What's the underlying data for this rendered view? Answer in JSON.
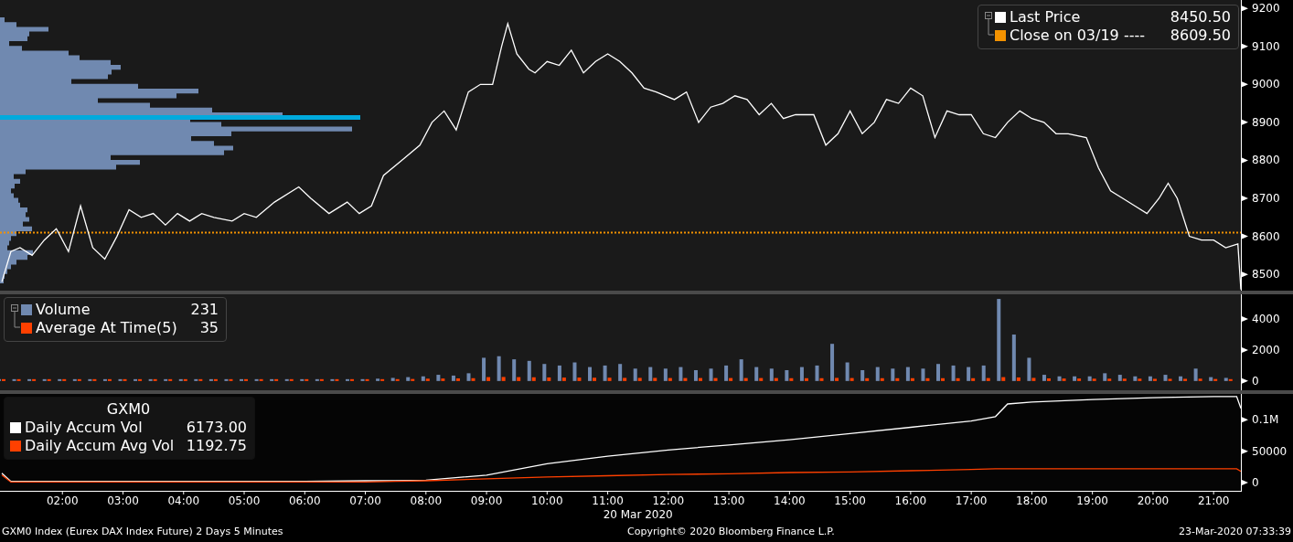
{
  "price_panel": {
    "legend_values": [
      "8450.50",
      "8609.50"
    ],
    "chart_data": {
      "type": "line",
      "legend": true,
      "xlim": [
        0.97,
        21.45
      ],
      "ylim": [
        8457,
        9222
      ],
      "yticks": [
        8500,
        8600,
        8700,
        8800,
        8900,
        9000,
        9100,
        9200
      ],
      "x": [
        1.0,
        1.15,
        1.3,
        1.5,
        1.7,
        1.9,
        2.1,
        2.3,
        2.5,
        2.7,
        2.9,
        3.1,
        3.3,
        3.5,
        3.7,
        3.9,
        4.1,
        4.3,
        4.5,
        4.8,
        5.0,
        5.2,
        5.5,
        5.9,
        6.1,
        6.4,
        6.7,
        6.9,
        7.1,
        7.3,
        7.6,
        7.9,
        8.1,
        8.3,
        8.5,
        8.7,
        8.9,
        9.1,
        9.25,
        9.35,
        9.5,
        9.7,
        9.8,
        10.0,
        10.2,
        10.4,
        10.6,
        10.8,
        11.0,
        11.2,
        11.4,
        11.6,
        11.8,
        12.1,
        12.3,
        12.5,
        12.7,
        12.9,
        13.1,
        13.3,
        13.5,
        13.7,
        13.9,
        14.1,
        14.4,
        14.6,
        14.8,
        15.0,
        15.2,
        15.4,
        15.6,
        15.8,
        16.0,
        16.2,
        16.4,
        16.6,
        16.8,
        17.0,
        17.2,
        17.4,
        17.6,
        17.8,
        18.0,
        18.2,
        18.4,
        18.6,
        18.9,
        19.1,
        19.3,
        19.5,
        19.7,
        19.9,
        20.1,
        20.25,
        20.4,
        20.6,
        20.8,
        21.0,
        21.2,
        21.4,
        21.45
      ],
      "series": [
        {
          "name": "Last Price",
          "color": "#ffffff",
          "values": [
            8480,
            8560,
            8570,
            8550,
            8590,
            8620,
            8560,
            8680,
            8570,
            8540,
            8600,
            8670,
            8650,
            8660,
            8630,
            8660,
            8640,
            8660,
            8650,
            8640,
            8660,
            8650,
            8690,
            8730,
            8700,
            8660,
            8690,
            8660,
            8680,
            8760,
            8800,
            8840,
            8900,
            8930,
            8880,
            8980,
            9000,
            9000,
            9100,
            9160,
            9080,
            9040,
            9030,
            9060,
            9050,
            9090,
            9030,
            9060,
            9080,
            9060,
            9030,
            8990,
            8980,
            8960,
            8980,
            8900,
            8940,
            8950,
            8970,
            8960,
            8920,
            8950,
            8910,
            8920,
            8920,
            8840,
            8870,
            8930,
            8870,
            8900,
            8960,
            8950,
            8990,
            8970,
            8860,
            8930,
            8920,
            8920,
            8870,
            8860,
            8900,
            8930,
            8910,
            8900,
            8870,
            8870,
            8860,
            8780,
            8720,
            8700,
            8680,
            8660,
            8700,
            8740,
            8700,
            8600,
            8590,
            8590,
            8570,
            8580,
            8460
          ]
        }
      ],
      "ref_lines": [
        {
          "axis": "y",
          "value": 8609.5,
          "label": "Close on 03/19 ----",
          "color": "#f39200"
        }
      ]
    }
  },
  "volume_panel": {
    "legend_values": [
      "231",
      "35"
    ],
    "chart_data": {
      "type": "bar",
      "stacked": false,
      "legend": true,
      "xlim": [
        0.97,
        21.45
      ],
      "ylim": [
        -600,
        5600
      ],
      "yticks": [
        0,
        2000,
        4000
      ],
      "x": [
        1.0,
        1.25,
        1.5,
        1.75,
        2.0,
        2.25,
        2.5,
        2.75,
        3.0,
        3.25,
        3.5,
        3.75,
        4.0,
        4.25,
        4.5,
        4.75,
        5.0,
        5.25,
        5.5,
        5.75,
        6.0,
        6.25,
        6.5,
        6.75,
        7.0,
        7.25,
        7.5,
        7.75,
        8.0,
        8.25,
        8.5,
        8.75,
        9.0,
        9.25,
        9.5,
        9.75,
        10.0,
        10.25,
        10.5,
        10.75,
        11.0,
        11.25,
        11.5,
        11.75,
        12.0,
        12.25,
        12.5,
        12.75,
        13.0,
        13.25,
        13.5,
        13.75,
        14.0,
        14.25,
        14.5,
        14.75,
        15.0,
        15.25,
        15.5,
        15.75,
        16.0,
        16.25,
        16.5,
        16.75,
        17.0,
        17.25,
        17.5,
        17.75,
        18.0,
        18.25,
        18.5,
        18.75,
        19.0,
        19.25,
        19.5,
        19.75,
        20.0,
        20.25,
        20.5,
        20.75,
        21.0,
        21.25
      ],
      "series": [
        {
          "name": "Volume",
          "color": "#7089b0",
          "values": [
            120,
            80,
            90,
            60,
            70,
            80,
            60,
            90,
            70,
            60,
            80,
            70,
            60,
            90,
            80,
            70,
            60,
            80,
            70,
            90,
            60,
            80,
            100,
            90,
            120,
            150,
            200,
            250,
            300,
            400,
            350,
            500,
            1500,
            1600,
            1400,
            1300,
            1100,
            1000,
            1200,
            900,
            1000,
            1100,
            800,
            900,
            800,
            900,
            700,
            800,
            1000,
            1400,
            900,
            800,
            700,
            900,
            1000,
            2400,
            1200,
            700,
            900,
            800,
            900,
            800,
            1100,
            1000,
            900,
            1000,
            5300,
            3000,
            1500,
            400,
            300,
            300,
            300,
            500,
            400,
            300,
            300,
            400,
            300,
            800,
            250,
            200
          ]
        },
        {
          "name": "Average At Time(5)",
          "color": "#ff4000",
          "values": [
            100,
            90,
            90,
            80,
            80,
            80,
            80,
            80,
            80,
            80,
            80,
            80,
            80,
            80,
            80,
            80,
            80,
            80,
            80,
            80,
            80,
            90,
            90,
            90,
            100,
            110,
            120,
            130,
            150,
            160,
            170,
            180,
            250,
            260,
            250,
            240,
            230,
            220,
            220,
            210,
            210,
            200,
            200,
            200,
            190,
            190,
            190,
            190,
            190,
            190,
            190,
            190,
            180,
            180,
            180,
            200,
            190,
            180,
            180,
            180,
            180,
            180,
            180,
            180,
            180,
            190,
            250,
            230,
            200,
            170,
            160,
            160,
            150,
            150,
            150,
            150,
            140,
            140,
            140,
            150,
            130,
            120
          ]
        }
      ]
    }
  },
  "accum_panel": {
    "legend_values": [
      "6173.00",
      "1192.75"
    ],
    "chart_data": {
      "type": "line",
      "legend": true,
      "title": "GXM0",
      "xlabel": "20 Mar 2020",
      "xlim": [
        0.97,
        21.45
      ],
      "ylim": [
        -13000,
        141000
      ],
      "xticks": [
        {
          "value": 2,
          "label": "02:00"
        },
        {
          "value": 3,
          "label": "03:00"
        },
        {
          "value": 4,
          "label": "04:00"
        },
        {
          "value": 5,
          "label": "05:00"
        },
        {
          "value": 6,
          "label": "06:00"
        },
        {
          "value": 7,
          "label": "07:00"
        },
        {
          "value": 8,
          "label": "08:00"
        },
        {
          "value": 9,
          "label": "09:00"
        },
        {
          "value": 10,
          "label": "10:00"
        },
        {
          "value": 11,
          "label": "11:00"
        },
        {
          "value": 12,
          "label": "12:00"
        },
        {
          "value": 13,
          "label": "13:00"
        },
        {
          "value": 14,
          "label": "14:00"
        },
        {
          "value": 15,
          "label": "15:00"
        },
        {
          "value": 16,
          "label": "16:00"
        },
        {
          "value": 17,
          "label": "17:00"
        },
        {
          "value": 18,
          "label": "18:00"
        },
        {
          "value": 19,
          "label": "19:00"
        },
        {
          "value": 20,
          "label": "20:00"
        },
        {
          "value": 21,
          "label": "21:00"
        }
      ],
      "yticks": [
        0,
        50000,
        {
          "value": 100000,
          "label": "0.1M"
        }
      ],
      "x": [
        1.0,
        1.15,
        2,
        3,
        4,
        5,
        6,
        7,
        7.5,
        8,
        9,
        10,
        11,
        12,
        13,
        14,
        15,
        16,
        17,
        17.4,
        17.6,
        18,
        19,
        20,
        21,
        21.38,
        21.45
      ],
      "series": [
        {
          "name": "Daily Accum Vol",
          "color": "#ffffff",
          "values": [
            15000,
            2000,
            2000,
            2000,
            2000,
            2000,
            2000,
            3000,
            3000,
            4000,
            12000,
            30000,
            42000,
            52000,
            60000,
            68000,
            78000,
            88000,
            98000,
            105000,
            125000,
            128000,
            132000,
            135000,
            137000,
            137000,
            118000
          ]
        },
        {
          "name": "Daily Accum Avg Vol",
          "color": "#ff4000",
          "values": [
            12000,
            1000,
            1000,
            1000,
            1000,
            1000,
            1000,
            1000,
            2000,
            3000,
            6000,
            9000,
            11000,
            13000,
            14000,
            16000,
            17000,
            19000,
            21000,
            22000,
            22000,
            22000,
            22000,
            22000,
            22000,
            22000,
            18000
          ]
        }
      ]
    }
  },
  "footer": {
    "left": "GXM0 Index (Eurex DAX Index Future) 2 Days 5 Minutes",
    "center": "Copyright© 2020 Bloomberg Finance L.P.",
    "right": "23-Mar-2020 07:33:39"
  }
}
